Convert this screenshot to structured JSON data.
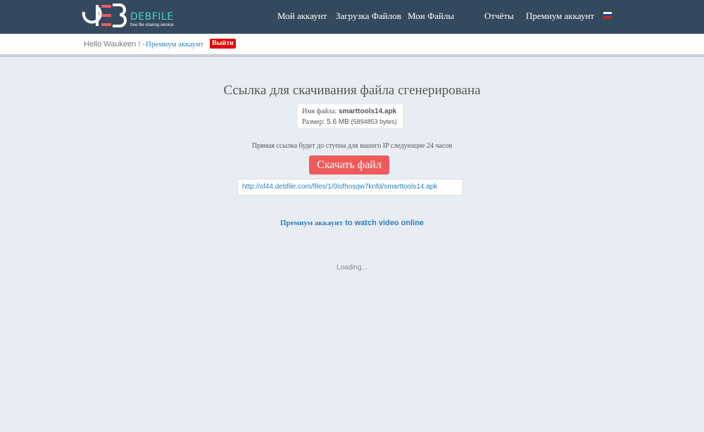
{
  "header": {
    "logo": {
      "name": "DEBFILE",
      "tagline": "free file sharing service"
    },
    "nav": [
      {
        "label": "Мой аккаунт"
      },
      {
        "label": "Загрузка Файлов"
      },
      {
        "label": "Мои Файлы"
      },
      {
        "label": "Отчёты"
      },
      {
        "label": "Премиум аккаунт"
      }
    ],
    "language_flag": "russian-flag-icon"
  },
  "userbar": {
    "greeting": "Hello Waukeen ! -",
    "premium_link": "Премиум аккаунт",
    "logout_label": "Выйти"
  },
  "main": {
    "title": "Ссылка для скачивания файла сгенерирована",
    "file": {
      "name_label": "Имя файла:",
      "name": "smarttools14.apk",
      "size_label": "Размер:",
      "size": "5.6 MB",
      "size_bytes": "(5894853 bytes)"
    },
    "direct_link_note": "Прямая ссылка будет до ступна для вашего IP следующие 24 часов",
    "download_button": "Скачать файл",
    "download_url": "http://sf44.debfile.com/files/1/0isfhosqw7knfd/smarttools14.apk",
    "watch_online": {
      "link": "Премиум аккаунт",
      "suffix": " to watch video online"
    },
    "loading": "Loading..."
  },
  "colors": {
    "header_bg": "#34495e",
    "accent_teal": "#4ed0c9",
    "link_blue": "#2e7fb8",
    "download_red": "#f05a5b",
    "logout_red": "#e40000",
    "page_bg": "#e8edf3"
  }
}
